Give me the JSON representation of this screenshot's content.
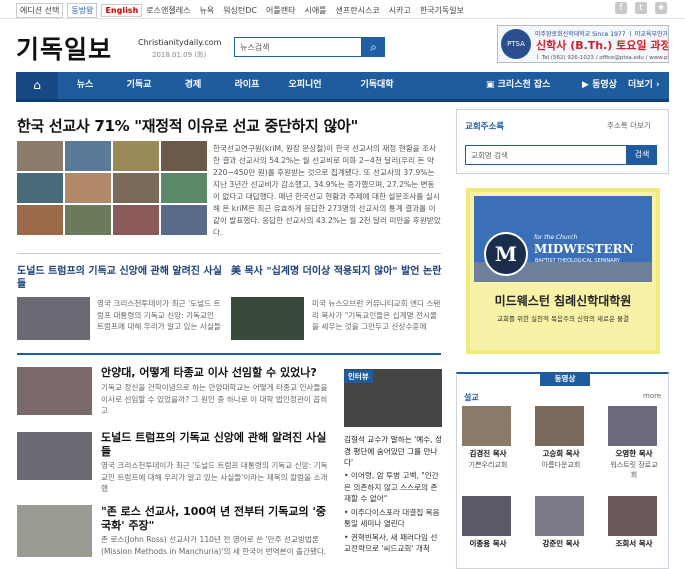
{
  "topbar": {
    "links": [
      "에디션 선택",
      "동방왕",
      "English",
      "로스앤젤레스",
      "뉴욕",
      "워싱턴DC",
      "어틀랜타",
      "시애틀",
      "샌프란시스코",
      "시카고",
      "한국기독일보"
    ]
  },
  "header": {
    "logo": "기독일보",
    "site": "Christianitydaily.com",
    "date": "2018.01.09 (화)",
    "search_placeholder": "뉴스검색"
  },
  "top_ad": {
    "line1": "미주장로회신학대학교 Since 1977 ㅣ 미교육부인가 학위과정",
    "line2": "신학사 (B.Th.) 토요일 과정 오픈!",
    "line3": "ㅣ Tel (562) 926-1023 / office@ptsa.edu / www.ptsa.edu"
  },
  "nav": {
    "items": [
      "뉴스",
      "기독교",
      "경제",
      "라이프",
      "오피니언",
      "기독대학"
    ],
    "cross": "크리스천 잡스",
    "video": "동영상",
    "more": "더보기"
  },
  "headline": {
    "title": "한국 선교사 71% \"재정적 이유로 선교 중단하지 않아\"",
    "body": "한국선교연구원(kriM, 원장 문상철)이 한국 선교사의 재정 현황을 조사한 결과 선교사의 54.2%는 월 선교비로 미화 2~4천 달러(우리 돈 약 220~450만 원)를 후원받는 것으로 집계됐다. 또 선교사의 37.9%는 지난 3년간 선교비가 감소했고, 34.9%는 증가했으며, 27.2%는 변동이 없다고 대답했다. 매년 한국선교 현황과 주제에 대한 설문조사를 실시해 온 kriM은 최근 유효하게 응답한 273명의 선교사의 통계 결과를 이같이 발표했다. 응답한 선교사의 43.2%는 월 2천 달러 미만을 후원받았다."
  },
  "sub_articles": [
    {
      "title": "도널드 트럼프의 기독교 신앙에 관해 알려진 사실들",
      "text": "영국 크리스천투데이가 최근 '도널드 트럼프 대통령의 기독교 신앙: 기독교인 트럼프에 대해 우리가 알고 있는 사실들"
    },
    {
      "title": "美 목사 \"십계명 더이상 적용되지 않아\" 발언 논란",
      "text": "미국 뉴스오브런 커뮤니티교회 앤디 스탠리 목사가 \"기독교인들은 십계명 전시물을 세우는 것을 그만두고 산상수훈에"
    }
  ],
  "list_articles": [
    {
      "title": "안양대, 어떻게 타종교 이사 선임할 수 있었나?",
      "text": "기독교 정신을 건학이념으로 하는 안양대학교는 어떻게 타종교 인사들을 이사로 선임할 수 있었을까? 그 원인 중 하나로 이 대학 법인정관이 꼽히고"
    },
    {
      "title": "도널드 트럼프의 기독교 신앙에 관해 알려진 사실들",
      "text": "영국 크리스천투데이가 최근 '도널드 트럼프 대통령의 기독교 신앙: 기독교인 트럼프에 대해 우리가 알고 있는 사실들'이라는 제목의 칼럼을 소개했"
    },
    {
      "title": "\"존 로스 선교사, 100여 년 전부터 기독교의 '중국화' 주장\"",
      "text": "존 로스(John Ross) 선교사가 110년 전 영어로 쓴 '만주 선교방법론(Mission Methods in Manchuria)'의 새 한국어 번역본이 출간됐다."
    }
  ],
  "interview": {
    "tag": "인터뷰",
    "title": "김형석 교수가 말하는 '예수, 성경 평단에 숨어있던 그를 만나다'",
    "bullets": [
      "이어령, 암 투병 고백, \"인간은 의존하지 않고 스스로의 존재할 수 없어\"",
      "미주다이스포라 대결집 복음통일 세미나 열린다",
      "권혁빈목사, 새 패러다임 선교전략으로 '씨드교회' 개척"
    ]
  },
  "right": {
    "church_title": "교회주소록",
    "church_more": "주소록 더보기",
    "church_placeholder": "교회명 검색",
    "church_btn": "검색",
    "ad_for": "for the Church",
    "ad_name": "MIDWESTERN",
    "ad_sub": "BAPTIST THEOLOGICAL SEMINARY",
    "ad_kr": "미드웨스턴 침례신학대학원",
    "ad_kr2": "교회를 위한 실천적 복음주의 신학의 새로운 물결",
    "video_tab": "동영상",
    "sermon_label": "설교",
    "sermon_more": "more",
    "people": [
      {
        "name": "김경진 목사",
        "church": "기쁜우리교회"
      },
      {
        "name": "고승희 목사",
        "church": "아름다운교회"
      },
      {
        "name": "오영한 목사",
        "church": "워스트릿 장로교회"
      },
      {
        "name": "이종용 목사",
        "church": ""
      },
      {
        "name": "강준민 목사",
        "church": ""
      },
      {
        "name": "조희서 목사",
        "church": ""
      }
    ]
  }
}
